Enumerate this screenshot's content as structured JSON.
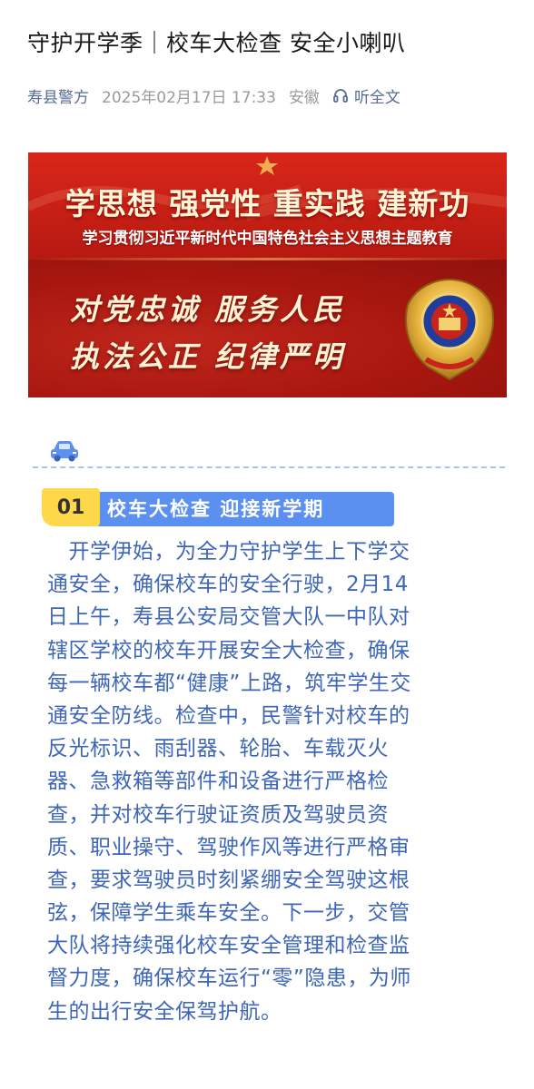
{
  "article": {
    "title": "守护开学季｜校车大检查 安全小喇叭",
    "author": "寿县警方",
    "date": "2025年02月17日 17:33",
    "location": "安徽",
    "listen_label": "听全文"
  },
  "banner": {
    "headline": "学思想 强党性 重实践 建新功",
    "subtitle": "学习贯彻习近平新时代中国特色社会主义思想主题教育",
    "slogan_line1": "对党忠诚 服务人民",
    "slogan_line2": "执法公正 纪律严明"
  },
  "section": {
    "number": "01",
    "title": "校车大检查 迎接新学期",
    "body_lines": [
      "　开学伊始，为全力守护学生上下学交",
      "通安全，确保校车的安全行驶，2月14",
      "日上午，寿县公安局交管大队一中队对",
      "辖区学校的校车开展安全大检查，确保",
      "每一辆校车都“健康”上路，筑牢学生交",
      "通安全防线。检查中，民警针对校车的",
      "反光标识、雨刮器、轮胎、车载灭火",
      "器、急救箱等部件和设备进行严格检",
      "查，并对校车行驶证资质及驾驶员资",
      "质、职业操守、驾驶作风等进行严格审",
      "查，要求驾驶员时刻紧绷安全驾驶这根",
      "弦，保障学生乘车安全。下一步，交管",
      "大队将持续强化校车安全管理和检查监",
      "督力度，确保校车运行“零”隐患，为师",
      "生的出行安全保驾护航。"
    ]
  },
  "icons": {
    "listen": "headphones-icon",
    "section": "car-icon",
    "emblem": "police-emblem-icon"
  },
  "colors": {
    "title": "#1a1a1a",
    "author_link": "#576b95",
    "meta_gray": "#9a9a9a",
    "banner_red": "#c71f15",
    "badge_yellow": "#ffd84a",
    "heading_blue": "#5b8ff0",
    "body_blue": "#3e66b8"
  }
}
